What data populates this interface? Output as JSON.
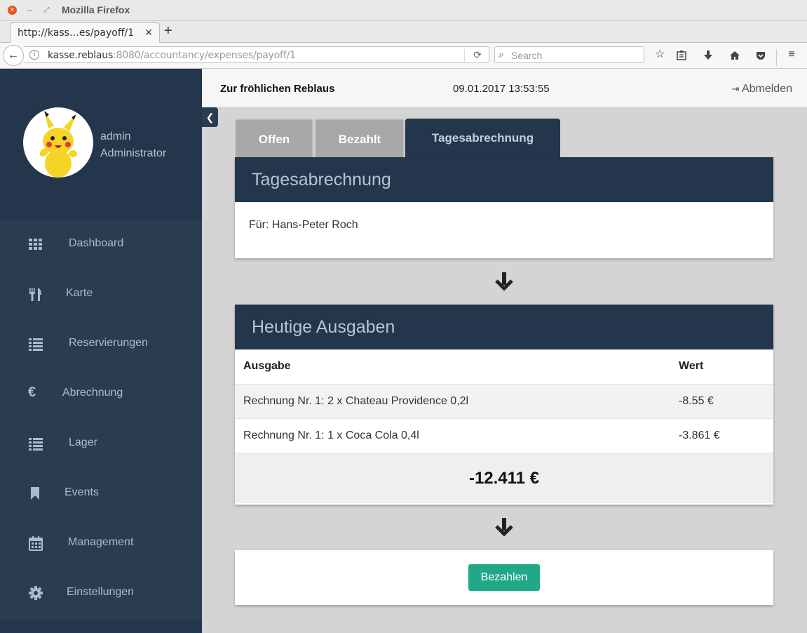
{
  "browser": {
    "window_title": "Mozilla Firefox",
    "tab_title": "http://kass…es/payoff/1",
    "url_host": "kasse.reblaus",
    "url_rest": ":8080/accountancy/expenses/payoff/1",
    "search_placeholder": "Search"
  },
  "sidebar": {
    "user_name": "admin",
    "user_role": "Administrator",
    "items": [
      {
        "label": "Dashboard",
        "icon": "grid-icon"
      },
      {
        "label": "Karte",
        "icon": "cutlery-icon"
      },
      {
        "label": "Reservierungen",
        "icon": "list-icon"
      },
      {
        "label": "Abrechnung",
        "icon": "euro-icon"
      },
      {
        "label": "Lager",
        "icon": "list-icon"
      },
      {
        "label": "Events",
        "icon": "bookmark-icon"
      },
      {
        "label": "Management",
        "icon": "calendar-icon"
      },
      {
        "label": "Einstellungen",
        "icon": "gear-icon"
      }
    ]
  },
  "header": {
    "brand": "Zur fröhlichen Reblaus",
    "datetime": "09.01.2017 13:53:55",
    "logout": "Abmelden"
  },
  "tabs": [
    {
      "label": "Offen",
      "active": false
    },
    {
      "label": "Bezahlt",
      "active": false
    },
    {
      "label": "Tagesabrechnung",
      "active": true
    }
  ],
  "payoff_panel": {
    "title": "Tagesabrechnung",
    "for_text": "Für: Hans-Peter Roch"
  },
  "expenses_panel": {
    "title": "Heutige Ausgaben",
    "columns": [
      "Ausgabe",
      "Wert"
    ],
    "rows": [
      {
        "item": "Rechnung Nr. 1: 2 x Chateau Providence 0,2l",
        "value": "-8.55 €"
      },
      {
        "item": "Rechnung Nr. 1: 1 x Coca Cola 0,4l",
        "value": "-3.861 €"
      }
    ],
    "total": "-12.411 €"
  },
  "pay_button": "Bezahlen",
  "colors": {
    "sidebar": "#2a3c50",
    "panel_header": "#24364b",
    "pay_button": "#1fa987"
  }
}
